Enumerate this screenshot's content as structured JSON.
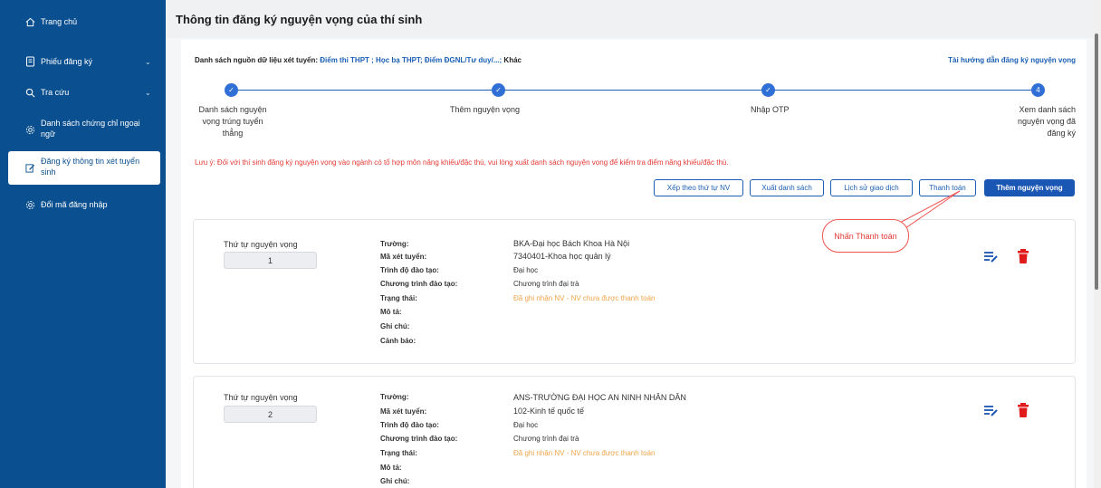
{
  "sidebar": {
    "items": [
      {
        "label": "Trang chủ",
        "icon": "home-icon"
      },
      {
        "label": "Phiếu đăng ký",
        "icon": "document-icon",
        "has_chevron": true
      },
      {
        "label": "Tra cứu",
        "icon": "search-icon",
        "has_chevron": true
      },
      {
        "label": "Danh sách chứng chỉ ngoại ngữ",
        "line1": "Danh sách chứng chỉ ngoại",
        "line2": "ngữ",
        "icon": "gear-icon"
      },
      {
        "label": "Đăng ký thông tin xét tuyển sinh",
        "line1": "Đăng ký thông tin xét tuyển",
        "line2": "sinh",
        "icon": "edit-icon",
        "active": true
      },
      {
        "label": "Đổi mã đăng nhập",
        "icon": "gear-icon"
      }
    ]
  },
  "header": {
    "title": "Thông tin đăng ký nguyện vọng của thí sinh"
  },
  "sources": {
    "lead": "Danh sách nguồn dữ liệu xét tuyển:",
    "list": "Điểm thi THPT ; Học bạ THPT; Điểm ĐGNL/Tư duy/...;",
    "other": "Khác"
  },
  "guide_link": "Tài hướng dẫn đăng ký nguyện vọng",
  "stepper": {
    "steps": [
      {
        "line1": "Danh sách nguyện",
        "line2": "vọng trúng tuyển",
        "line3": "thẳng",
        "marker": "✓"
      },
      {
        "line1": "Thêm nguyện vọng",
        "marker": "✓"
      },
      {
        "line1": "Nhập OTP",
        "marker": "✓"
      },
      {
        "line1": "Xem danh sách",
        "line2": "nguyện vọng đã",
        "line3": "đăng ký",
        "marker": "4"
      }
    ]
  },
  "warning": "Lưu ý: Đối với thí sinh đăng ký nguyện vọng vào ngành có tổ hợp môn năng khiếu/đặc thù, vui lòng xuất danh sách nguyện vọng để kiểm tra điểm năng khiếu/đặc thù.",
  "actions": {
    "sort": "Xếp theo thứ tự NV",
    "export": "Xuất danh sách",
    "history": "Lịch sử giao dịch",
    "pay": "Thanh toán",
    "add": "Thêm nguyện vọng"
  },
  "callout": "Nhấn Thanh toán",
  "labels": {
    "order": "Thứ tự nguyện vọng",
    "school": "Trường:",
    "major": "Mã xét tuyển:",
    "level": "Trình độ đào tạo:",
    "program": "Chương trình đào tạo:",
    "status": "Trạng thái:",
    "desc": "Mô tả:",
    "note": "Ghi chú:",
    "alert": "Cảnh báo:"
  },
  "cards": [
    {
      "order": "1",
      "school": "BKA-Đại học Bách Khoa Hà Nội",
      "major": "7340401-Khoa học quản lý",
      "level": "Đại học",
      "program": "Chương trình đại trà",
      "status": "Đã ghi nhận NV - NV chưa được thanh toán"
    },
    {
      "order": "2",
      "school": "ANS-TRƯỜNG ĐẠI HỌC AN NINH NHÂN DÂN",
      "major": "102-Kinh tế quốc tế",
      "level": "Đại học",
      "program": "Chương trình đại trà",
      "status": "Đã ghi nhận NV - NV chưa được thanh toán"
    }
  ],
  "colors": {
    "sidebar": "#0a4f8f",
    "accent": "#1a56b3",
    "warning": "#e53935",
    "status": "#f0a54a"
  }
}
